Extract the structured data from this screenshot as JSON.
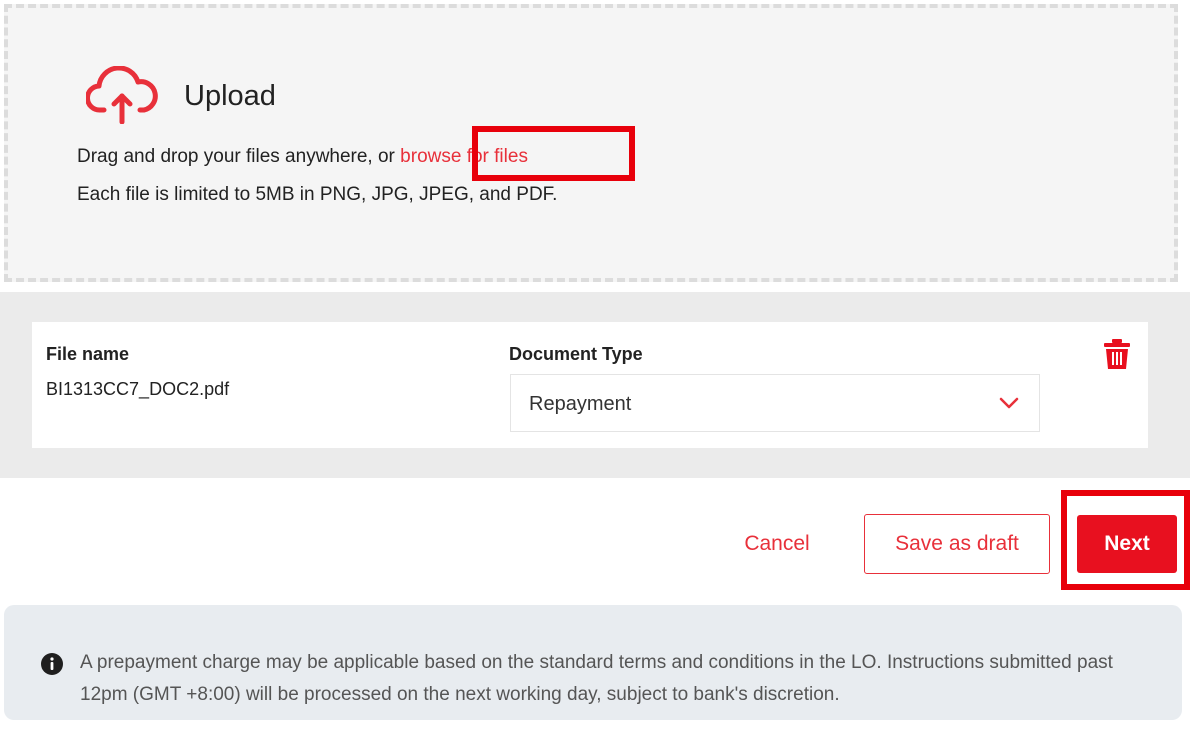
{
  "upload": {
    "title": "Upload",
    "instruction_prefix": "Drag and drop your files anywhere, or ",
    "browse_link": "browse for files",
    "limit_text": "Each file is limited to 5MB in PNG, JPG, JPEG, and PDF.",
    "icon": "cloud-upload-icon"
  },
  "file_table": {
    "file_name_header": "File name",
    "document_type_header": "Document Type",
    "rows": [
      {
        "file_name": "BI1313CC7_DOC2.pdf",
        "document_type": "Repayment"
      }
    ],
    "delete_icon": "trash-icon",
    "dropdown_icon": "chevron-down-icon"
  },
  "actions": {
    "cancel_label": "Cancel",
    "save_draft_label": "Save as draft",
    "next_label": "Next"
  },
  "notice": {
    "icon": "info-icon",
    "text": "A prepayment charge may be applicable based on the standard terms and conditions in the LO. Instructions submitted past 12pm (GMT +8:00) will be processed on the next working day, subject to bank's discretion."
  },
  "colors": {
    "accent": "#e8303a",
    "primary_button": "#e8101f",
    "highlight": "#e8000b",
    "notice_bg": "#e8ecf0"
  }
}
